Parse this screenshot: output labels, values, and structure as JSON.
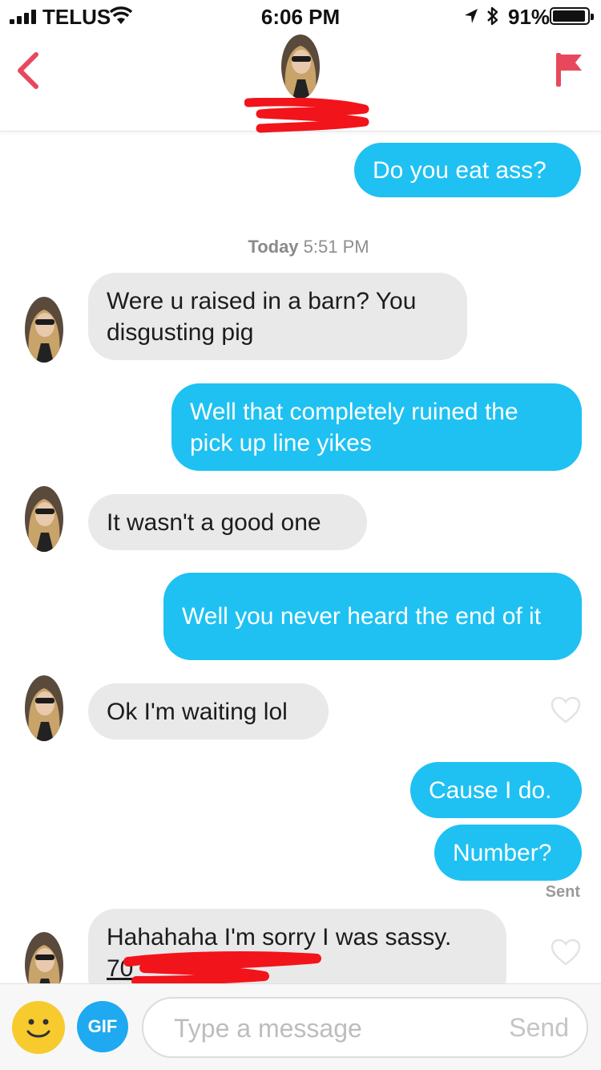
{
  "status_bar": {
    "carrier": "TELUS",
    "time": "6:06 PM",
    "battery_percent": "91%",
    "battery_level": 0.91
  },
  "header": {
    "back_icon": "chevron-left-icon",
    "report_icon": "flag-icon",
    "accent_color": "#e8485c"
  },
  "conversation": {
    "timestamp_day": "Today",
    "timestamp_time": "5:51 PM",
    "messages": [
      {
        "from": "me",
        "text": "Do you eat ass?"
      },
      {
        "from": "match",
        "text": "Were u raised in a barn? You disgusting pig"
      },
      {
        "from": "me",
        "text": "Well that completely ruined the pick up line yikes"
      },
      {
        "from": "match",
        "text": "It wasn't a good one"
      },
      {
        "from": "me",
        "text": "Well you never heard the end of it"
      },
      {
        "from": "match",
        "text": "Ok I'm waiting lol"
      },
      {
        "from": "me",
        "text": "Cause I do."
      },
      {
        "from": "me",
        "text": "Number?"
      },
      {
        "from": "match",
        "text": "Hahahaha I'm sorry I was sassy."
      }
    ],
    "partial_number": "70",
    "sent_status": "Sent"
  },
  "input_bar": {
    "gif_label": "GIF",
    "placeholder": "Type a message",
    "send_label": "Send"
  },
  "colors": {
    "outgoing_bubble": "#1ec1f2",
    "incoming_bubble": "#e9e9e9",
    "gif_button": "#1ea9f0",
    "emoji_button": "#f7ca2e"
  }
}
